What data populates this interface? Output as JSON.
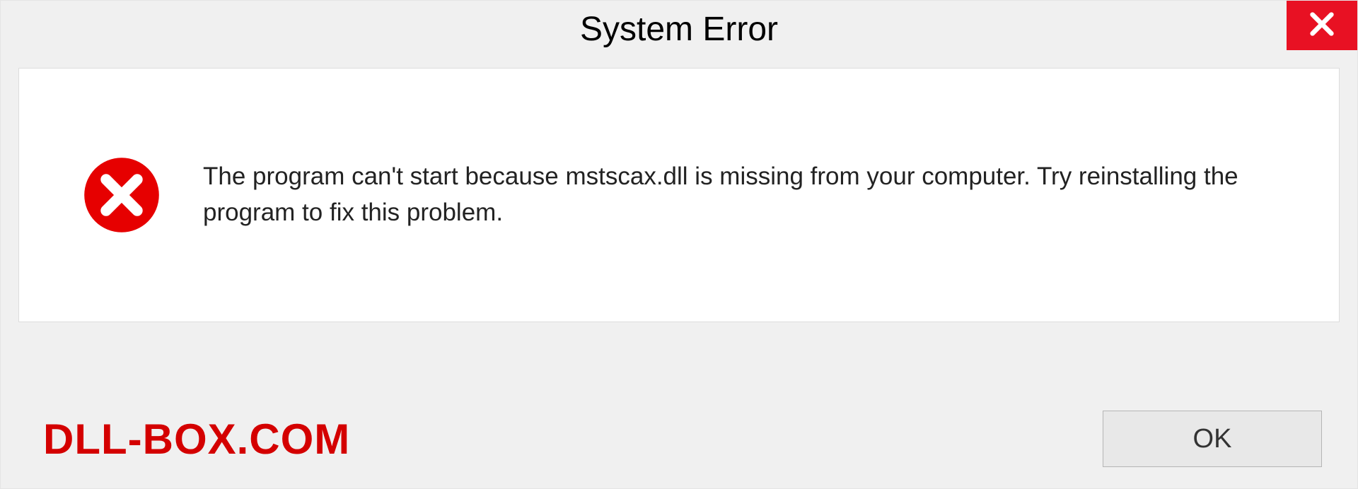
{
  "title": "System Error",
  "message": "The program can't start because mstscax.dll is missing from your computer. Try reinstalling the program to fix this problem.",
  "watermark": "DLL-BOX.COM",
  "buttons": {
    "ok": "OK"
  },
  "colors": {
    "close_bg": "#e81123",
    "error_icon": "#e60000",
    "watermark": "#d40000"
  }
}
